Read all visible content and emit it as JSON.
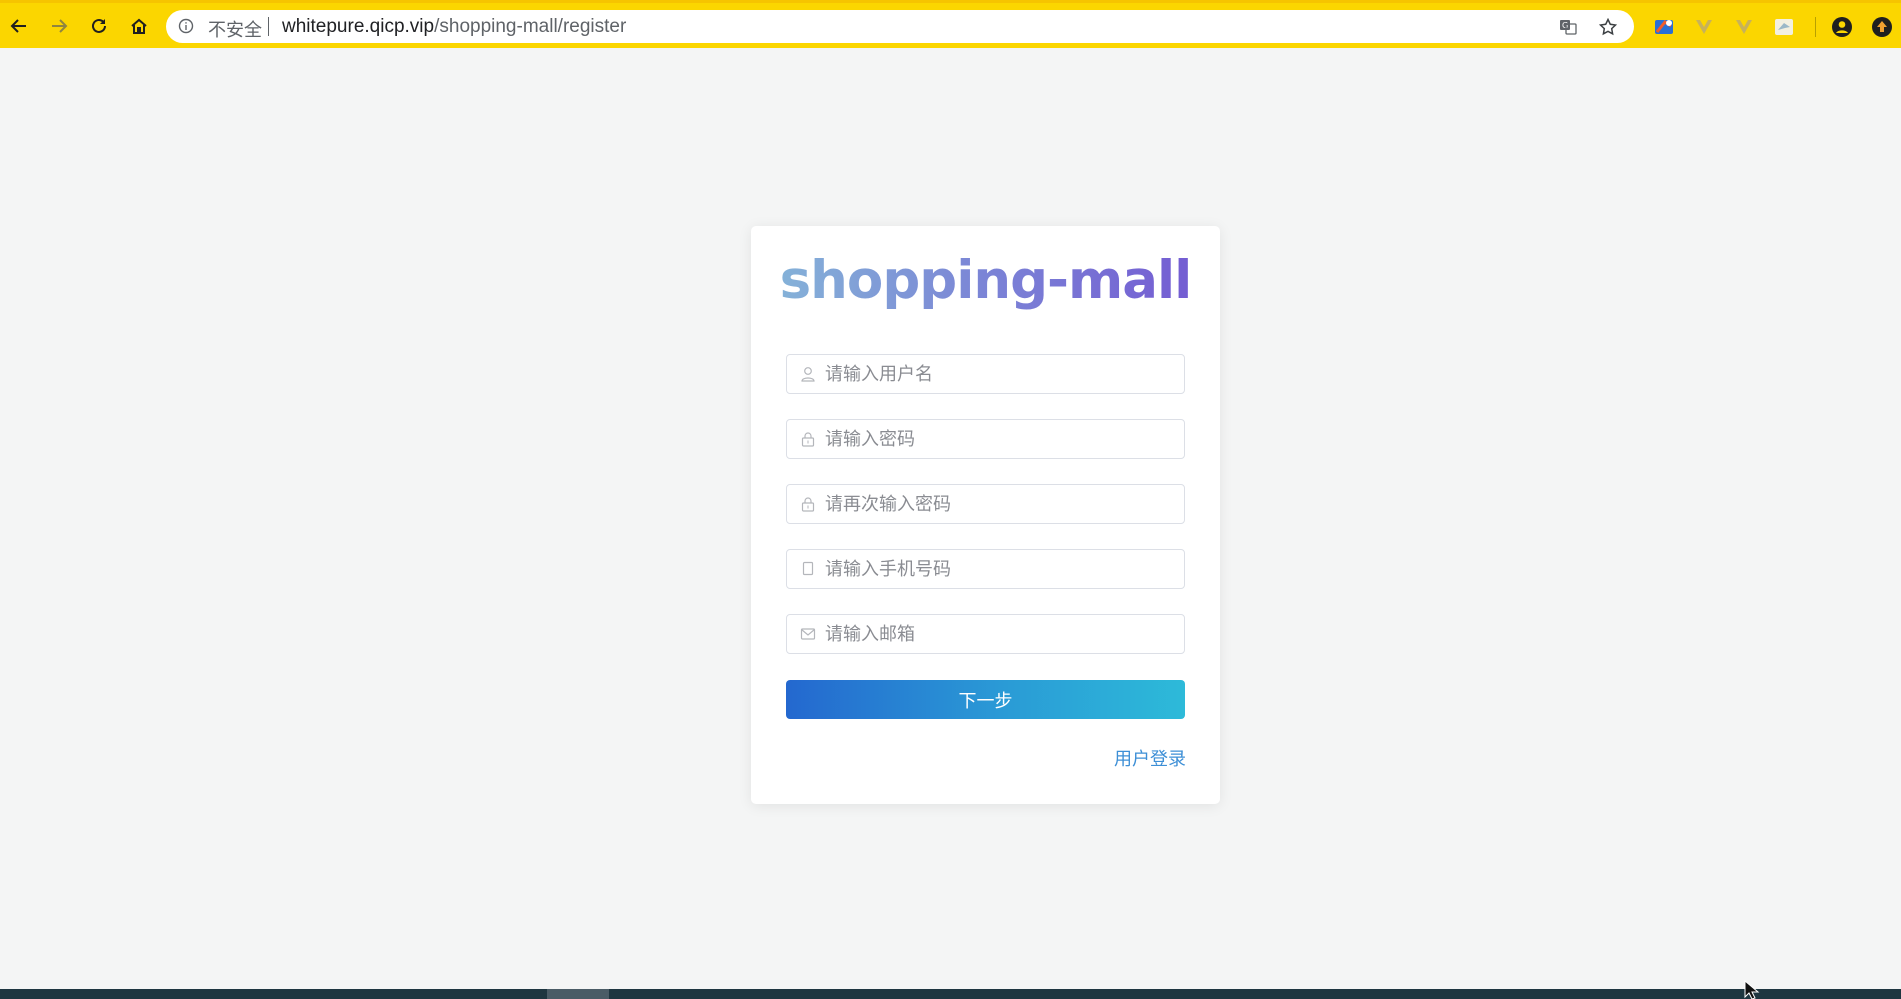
{
  "browser": {
    "insecure_label": "不安全",
    "url_host": "whitepure.qicp.vip",
    "url_path": "/shopping-mall/register",
    "icons": [
      "back-icon",
      "forward-icon",
      "reload-icon",
      "home-icon",
      "info-icon",
      "translate-icon",
      "bookmark-star-icon",
      "extension-icons",
      "profile-icon"
    ],
    "accent_color": "#fbd600"
  },
  "register": {
    "logo": "shopping-mall",
    "fields": [
      {
        "icon": "user-icon",
        "placeholder": "请输入用户名"
      },
      {
        "icon": "lock-icon",
        "placeholder": "请输入密码"
      },
      {
        "icon": "lock-icon",
        "placeholder": "请再次输入密码"
      },
      {
        "icon": "mobile-icon",
        "placeholder": "请输入手机号码"
      },
      {
        "icon": "mail-icon",
        "placeholder": "请输入邮箱"
      }
    ],
    "next_label": "下一步",
    "login_link": "用户登录",
    "button_gradient": [
      "#2468cf",
      "#2dbad9"
    ],
    "link_color": "#3d8fd6"
  }
}
